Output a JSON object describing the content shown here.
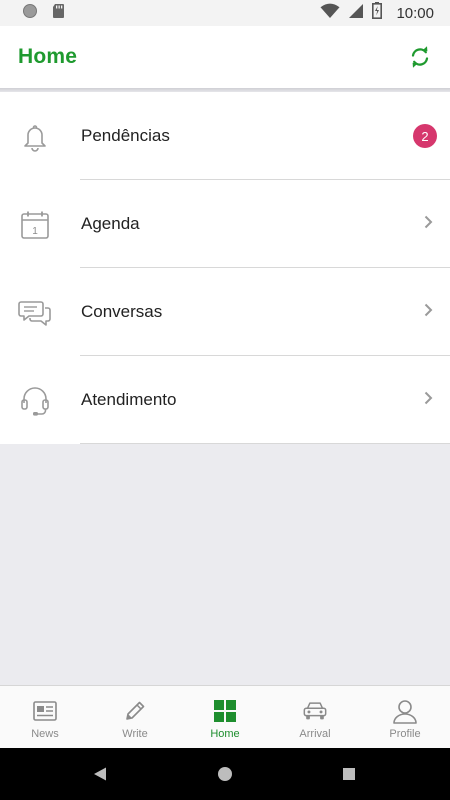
{
  "status_bar": {
    "time": "10:00"
  },
  "app_bar": {
    "title": "Home"
  },
  "menu": [
    {
      "label": "Pendências",
      "icon": "bell-icon",
      "badge": "2"
    },
    {
      "label": "Agenda",
      "icon": "calendar-icon",
      "calendar_day": "1"
    },
    {
      "label": "Conversas",
      "icon": "chat-bubbles-icon"
    },
    {
      "label": "Atendimento",
      "icon": "headset-icon"
    }
  ],
  "bottom_nav": [
    {
      "label": "News",
      "icon": "newspaper-icon",
      "active": false
    },
    {
      "label": "Write",
      "icon": "pencil-icon",
      "active": false
    },
    {
      "label": "Home",
      "icon": "grid-icon",
      "active": true
    },
    {
      "label": "Arrival",
      "icon": "car-icon",
      "active": false
    },
    {
      "label": "Profile",
      "icon": "person-icon",
      "active": false
    }
  ],
  "colors": {
    "accent": "#1f9a2f",
    "badge": "#d6376d",
    "background": "#ebebef"
  }
}
